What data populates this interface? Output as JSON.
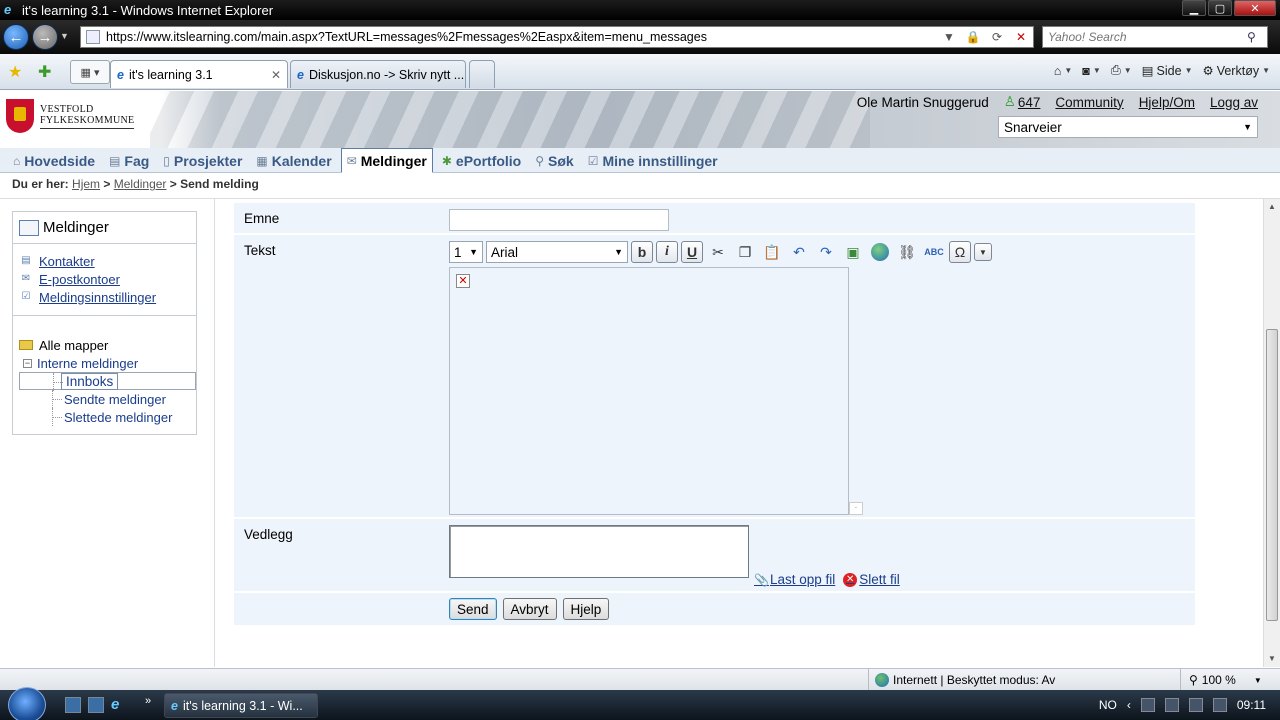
{
  "window": {
    "title": "it's learning 3.1 - Windows Internet Explorer",
    "minimize": "▁",
    "maximize": "▢",
    "close": "✕"
  },
  "browser": {
    "url": "https://www.itslearning.com/main.aspx?TextURL=messages%2Fmessages%2Easpx&item=menu_messages",
    "search_placeholder": "Yahoo! Search",
    "tabs": [
      {
        "label": "it's learning 3.1",
        "active": true
      },
      {
        "label": "Diskusjon.no -> Skriv nytt ...",
        "active": false
      }
    ],
    "commands": {
      "page": "Side",
      "tools": "Verktøy"
    }
  },
  "site": {
    "logo_line1": "VESTFOLD",
    "logo_line2": "FYLKESKOMMUNE",
    "user": "Ole Martin Snuggerud",
    "online_count": "647",
    "links": {
      "community": "Community",
      "help": "Hjelp/Om",
      "logout": "Logg av"
    },
    "shortcuts": "Snarveier"
  },
  "mainnav": [
    {
      "label": "Hovedside",
      "icon": "home-icon",
      "active": false
    },
    {
      "label": "Fag",
      "icon": "book-icon",
      "active": false
    },
    {
      "label": "Prosjekter",
      "icon": "clipboard-icon",
      "active": false
    },
    {
      "label": "Kalender",
      "icon": "calendar-icon",
      "active": false
    },
    {
      "label": "Meldinger",
      "icon": "envelope-icon",
      "active": true
    },
    {
      "label": "ePortfolio",
      "icon": "person-icon",
      "active": false
    },
    {
      "label": "Søk",
      "icon": "magnifier-icon",
      "active": false
    },
    {
      "label": "Mine innstillinger",
      "icon": "settings-checklist-icon",
      "active": false
    }
  ],
  "breadcrumb": {
    "prefix": "Du er her:",
    "home": "Hjem",
    "section": "Meldinger",
    "current": "Send melding"
  },
  "sidebar": {
    "title": "Meldinger",
    "links": [
      {
        "label": "Kontakter",
        "icon": "contacts-icon"
      },
      {
        "label": "E-postkontoer",
        "icon": "email-accounts-icon"
      },
      {
        "label": "Meldingsinnstillinger",
        "icon": "settings-icon"
      }
    ],
    "tree": {
      "root": "Alle mapper",
      "node": "Interne meldinger",
      "leaves": [
        "Innboks",
        "Sendte meldinger",
        "Slettede meldinger"
      ]
    }
  },
  "form": {
    "subject_label": "Emne",
    "subject_value": "",
    "text_label": "Tekst",
    "font_size": "1",
    "font_family": "Arial",
    "toolbar": {
      "bold": "b",
      "italic": "i",
      "underline": "U",
      "spell": "ABC",
      "omega": "Ω"
    },
    "attachment_label": "Vedlegg",
    "upload": "Last opp fil",
    "delete": "Slett fil",
    "buttons": {
      "send": "Send",
      "cancel": "Avbryt",
      "help": "Hjelp"
    }
  },
  "statusbar": {
    "zone": "Internett | Beskyttet modus: Av",
    "zoom": "100 %"
  },
  "taskbar": {
    "task": "it's learning 3.1 - Wi...",
    "lang": "NO",
    "time": "09:11"
  }
}
